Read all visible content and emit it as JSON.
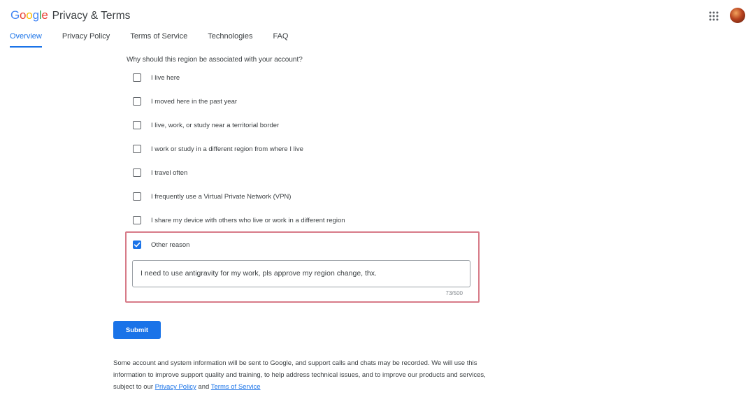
{
  "header": {
    "logo_letters": [
      "G",
      "o",
      "o",
      "g",
      "l",
      "e"
    ],
    "title": "Privacy & Terms",
    "tabs": [
      {
        "label": "Overview"
      },
      {
        "label": "Privacy Policy"
      },
      {
        "label": "Terms of Service"
      },
      {
        "label": "Technologies"
      },
      {
        "label": "FAQ"
      }
    ],
    "active_tab": "Overview",
    "apps_icon": "apps-grid-icon",
    "avatar_icon": "account-avatar"
  },
  "form": {
    "question": "Why should this region be associated with your account?",
    "options": [
      {
        "label": "I live here",
        "checked": false
      },
      {
        "label": "I moved here in the past year",
        "checked": false
      },
      {
        "label": "I live, work, or study near a territorial border",
        "checked": false
      },
      {
        "label": "I work or study in a different region from where I live",
        "checked": false
      },
      {
        "label": "I travel often",
        "checked": false
      },
      {
        "label": "I frequently use a Virtual Private Network (VPN)",
        "checked": false
      },
      {
        "label": "I share my device with others who live or work in a different region",
        "checked": false
      },
      {
        "label": "Other reason",
        "checked": true
      }
    ],
    "other_reason_value": "I need to use antigravity for my work, pls approve my region change, thx.",
    "char_counter": "73/500",
    "submit_label": "Submit"
  },
  "disclaimer": {
    "text_before": "Some account and system information will be sent to Google, and support calls and chats may be recorded. We will use this information to improve support quality and training, to help address technical issues, and to improve our products and services, subject to our ",
    "privacy_link": "Privacy Policy",
    "and": " and ",
    "terms_link": "Terms of Service"
  },
  "colors": {
    "accent": "#1a73e8",
    "highlight_border": "#d77b88"
  }
}
